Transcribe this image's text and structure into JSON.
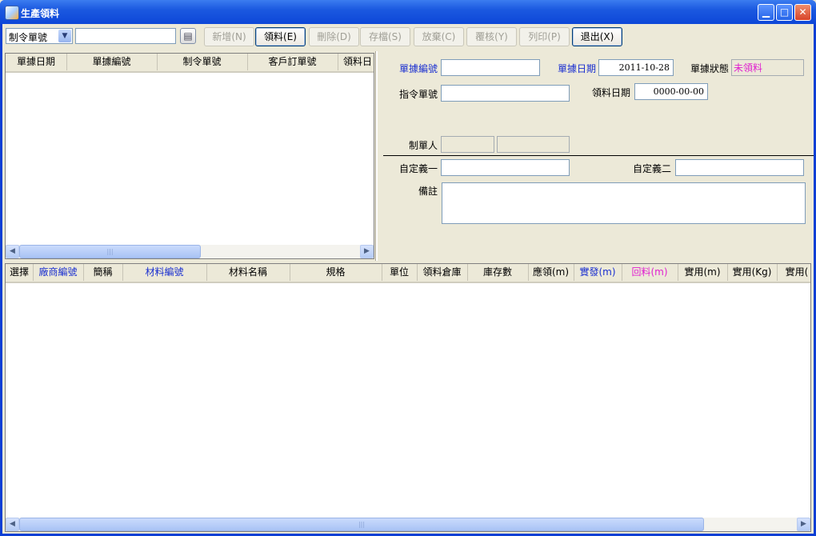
{
  "window": {
    "title": "生產領料",
    "controls": {
      "minimize": "▁",
      "maximize": "□",
      "close": "✕"
    }
  },
  "toolbar": {
    "search_field": "制令單號",
    "search_value": "",
    "buttons": [
      {
        "label": "新增(N)",
        "enabled": false
      },
      {
        "label": "領料(E)",
        "enabled": true
      },
      {
        "label": "刪除(D)",
        "enabled": false
      },
      {
        "label": "存檔(S)",
        "enabled": false
      },
      {
        "label": "放棄(C)",
        "enabled": false
      },
      {
        "label": "覆核(Y)",
        "enabled": false
      },
      {
        "label": "列印(P)",
        "enabled": false
      },
      {
        "label": "退出(X)",
        "enabled": true
      }
    ]
  },
  "doc_list": {
    "columns": [
      "單據日期",
      "單據編號",
      "制令單號",
      "客戶訂單號",
      "領料日"
    ]
  },
  "form": {
    "doc_no_label": "單據編號",
    "doc_no_value": "",
    "doc_date_label": "單據日期",
    "doc_date_value": "2011-10-28",
    "status_label": "單據狀態",
    "status_value": "未領料",
    "order_no_label": "指令單號",
    "order_no_value": "",
    "pick_date_label": "領料日期",
    "pick_date_value": "0000-00-00",
    "creator_label": "制單人",
    "custom1_label": "自定義一",
    "custom2_label": "自定義二",
    "remark_label": "備註"
  },
  "detail": {
    "columns": [
      {
        "label": "選擇",
        "color": "#000000"
      },
      {
        "label": "廠商編號",
        "color": "#1a2fd0"
      },
      {
        "label": "簡稱",
        "color": "#000000"
      },
      {
        "label": "材料編號",
        "color": "#1a2fd0"
      },
      {
        "label": "材料名稱",
        "color": "#000000"
      },
      {
        "label": "規格",
        "color": "#000000"
      },
      {
        "label": "單位",
        "color": "#000000"
      },
      {
        "label": "領料倉庫",
        "color": "#000000"
      },
      {
        "label": "庫存數",
        "color": "#000000"
      },
      {
        "label": "應領(m)",
        "color": "#000000"
      },
      {
        "label": "實發(m)",
        "color": "#1a2fd0"
      },
      {
        "label": "回料(m)",
        "color": "#e020d0"
      },
      {
        "label": "實用(m)",
        "color": "#000000"
      },
      {
        "label": "實用(Kg)",
        "color": "#000000"
      },
      {
        "label": "實用(",
        "color": "#000000"
      }
    ]
  },
  "scrollbar": {
    "left": "◀",
    "right": "▶",
    "grip": "|||"
  },
  "icons": {
    "dropdown": "▼",
    "lookup": "▤"
  }
}
